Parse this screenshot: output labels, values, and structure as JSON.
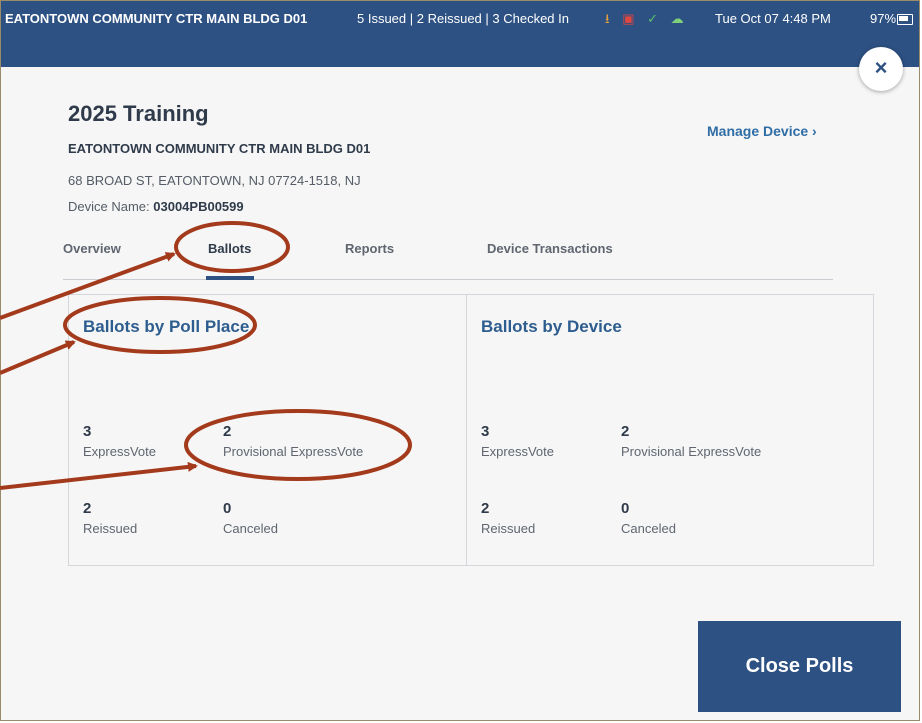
{
  "status_bar": {
    "site": "EATONTOWN COMMUNITY CTR MAIN BLDG D01",
    "counts": "5 Issued | 2 Reissued | 3 Checked In",
    "datetime": "Tue Oct 07  4:48 PM",
    "battery": "97%",
    "icons": [
      "download-icon",
      "printer-icon",
      "check-icon",
      "cloud-icon",
      "battery-icon"
    ],
    "color": "#2d5183"
  },
  "header": {
    "title": "2025 Training",
    "site_name": "EATONTOWN COMMUNITY CTR MAIN BLDG D01",
    "address": "68 BROAD ST, EATONTOWN, NJ 07724-1518, NJ",
    "device_label": "Device Name:",
    "device_value": "03004PB00599",
    "manage_link": "Manage Device ›",
    "close_symbol": "×"
  },
  "tabs": [
    {
      "label": "Overview",
      "active": false
    },
    {
      "label": "Ballots",
      "active": true
    },
    {
      "label": "Reports",
      "active": false
    },
    {
      "label": "Device Transactions",
      "active": false
    }
  ],
  "cards": {
    "poll_place": {
      "title": "Ballots by Poll Place",
      "stats": [
        {
          "value": "3",
          "label": "ExpressVote"
        },
        {
          "value": "2",
          "label": "Provisional ExpressVote"
        },
        {
          "value": "2",
          "label": "Reissued"
        },
        {
          "value": "0",
          "label": "Canceled"
        }
      ]
    },
    "device": {
      "title": "Ballots by Device",
      "stats": [
        {
          "value": "3",
          "label": "ExpressVote"
        },
        {
          "value": "2",
          "label": "Provisional ExpressVote"
        },
        {
          "value": "2",
          "label": "Reissued"
        },
        {
          "value": "0",
          "label": "Canceled"
        }
      ]
    }
  },
  "actions": {
    "close_polls": "Close Polls"
  },
  "annotation_color": "#a33a1c"
}
